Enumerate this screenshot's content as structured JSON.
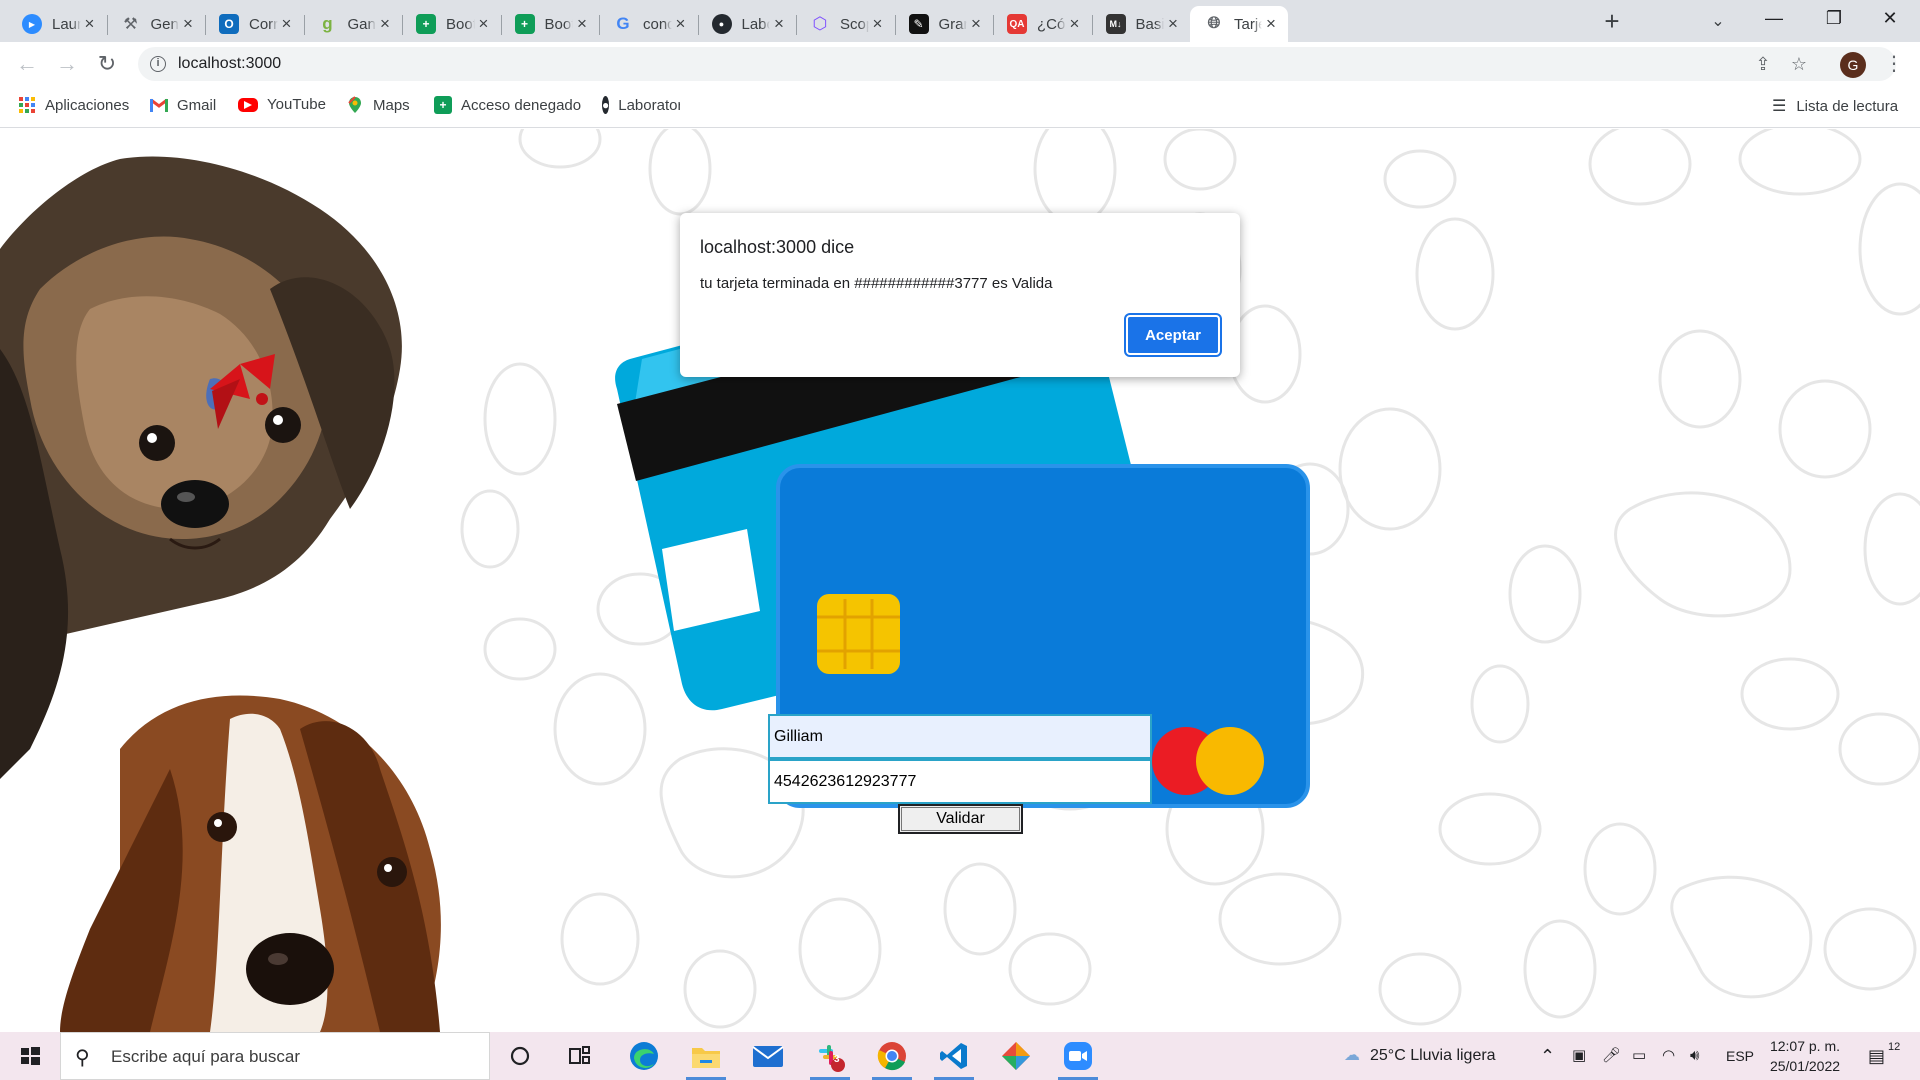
{
  "browser": {
    "tabs": [
      {
        "title": "Launch",
        "icon": "zoom-icon",
        "color": "#2d8cff",
        "active": false
      },
      {
        "title": "Generate",
        "icon": "tools-icon",
        "color": "#5f6368",
        "active": false
      },
      {
        "title": "Correo",
        "icon": "outlook-icon",
        "color": "#0f6cbd",
        "active": false
      },
      {
        "title": "Ganar",
        "icon": "grammarly-g-icon",
        "color": "#7cb342",
        "active": false
      },
      {
        "title": "Bootcamp",
        "icon": "sheets-icon",
        "color": "#0f9d58",
        "active": false
      },
      {
        "title": "Bootcamp",
        "icon": "sheets-icon",
        "color": "#0f9d58",
        "active": false
      },
      {
        "title": "condicionales",
        "icon": "google-icon",
        "color": "#4285f4",
        "active": false
      },
      {
        "title": "Laboratoria",
        "icon": "github-icon",
        "color": "#24292f",
        "active": false
      },
      {
        "title": "Scope",
        "icon": "hex-icon",
        "color": "#7c4dff",
        "active": false
      },
      {
        "title": "Gramática",
        "icon": "grammar-icon",
        "color": "#111111",
        "active": false
      },
      {
        "title": "¿Cómo",
        "icon": "qa-icon",
        "color": "#e53935",
        "active": false
      },
      {
        "title": "Basic",
        "icon": "markdown-icon",
        "color": "#333333",
        "active": false
      },
      {
        "title": "Tarjeta",
        "icon": "globe-icon",
        "color": "#5f6368",
        "active": true
      }
    ],
    "url": "localhost:3000",
    "profile_initial": "G",
    "bookmarks": [
      {
        "label": "Aplicaciones",
        "icon": "apps-grid-icon"
      },
      {
        "label": "Gmail",
        "icon": "gmail-icon"
      },
      {
        "label": "YouTube",
        "icon": "youtube-icon"
      },
      {
        "label": "Maps",
        "icon": "maps-icon"
      },
      {
        "label": "Acceso denegado",
        "icon": "sheets-icon"
      },
      {
        "label": "Laboratoria",
        "icon": "github-icon"
      }
    ],
    "reading_list": "Lista de lectura"
  },
  "page": {
    "name_value": "Gilliam",
    "card_number_value": "4542623612923777",
    "validate_label": "Validar"
  },
  "alert": {
    "title": "localhost:3000 dice",
    "message": "tu tarjeta terminada en ############3777 es Valida",
    "ok_label": "Aceptar"
  },
  "taskbar": {
    "search_placeholder": "Escribe aquí para buscar",
    "weather": "25°C  Lluvia ligera",
    "language": "ESP",
    "time": "12:07 p. m.",
    "date": "25/01/2022",
    "notification_count": "12",
    "slack_badge": "3"
  }
}
